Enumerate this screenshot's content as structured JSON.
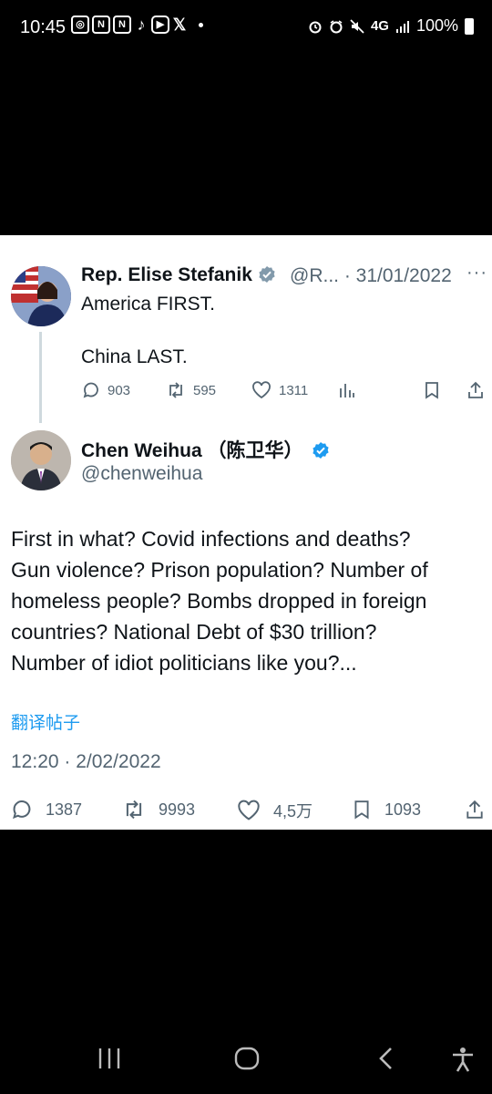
{
  "status_bar": {
    "time": "10:45",
    "network": "4G",
    "battery": "100%"
  },
  "original_tweet": {
    "author_name": "Rep. Elise Stefanik",
    "handle_date": "@R... · 31/01/2022",
    "line1": "America FIRST.",
    "line2": "China LAST.",
    "replies": "903",
    "retweets": "595",
    "likes": "1311"
  },
  "reply_tweet": {
    "author_name": "Chen Weihua （陈卫华）",
    "handle": "@chenweihua",
    "body_lines": [
      "First in what? Covid infections and deaths?",
      "Gun violence? Prison population? Number of",
      "homeless people? Bombs dropped in foreign",
      "countries? National Debt of $30 trillion?",
      "Number of idiot politicians like you?..."
    ],
    "translate_label": "翻译帖子",
    "timestamp": "12:20 · 2/02/2022",
    "replies": "1387",
    "retweets": "9993",
    "likes": "4,5万",
    "bookmarks": "1093"
  },
  "colors": {
    "accent": "#1d9bf0",
    "muted": "#536471",
    "text": "#0f1419"
  }
}
